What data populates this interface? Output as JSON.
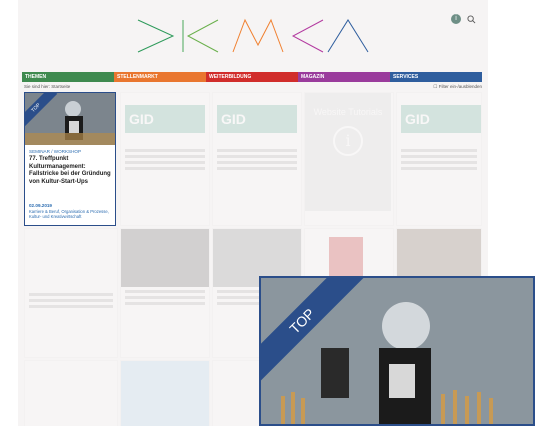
{
  "nav": [
    {
      "label": "THEMEN",
      "color": "#3f8a4f"
    },
    {
      "label": "STELLENMARKT",
      "color": "#e9762f"
    },
    {
      "label": "WEITERBILDUNG",
      "color": "#d12d2b"
    },
    {
      "label": "MAGAZIN",
      "color": "#9a3b9c"
    },
    {
      "label": "SERVICES",
      "color": "#2f5e9e"
    }
  ],
  "breadcrumb": {
    "left": "Sie sind hier: Startseite",
    "right": "Filter ein-/ausblenden"
  },
  "featured": {
    "ribbon": "TOP",
    "category": "SEMINAR / WORKSHOP",
    "title": "77. Treffpunkt Kulturmanagement: Fallstricke bei der Gründung von Kultur-Start-Ups",
    "date": "02.09.2019",
    "tags": "Karriere & Beruf, Organisation & Prozesse, Kultur- und Kreativwirtschaft"
  },
  "info_tile": {
    "heading": "Website Tutorials",
    "icon": "info-icon"
  },
  "gid_label": "GID",
  "zoom": {
    "ribbon": "TOP"
  },
  "header": {
    "avatar_letter": "i"
  }
}
